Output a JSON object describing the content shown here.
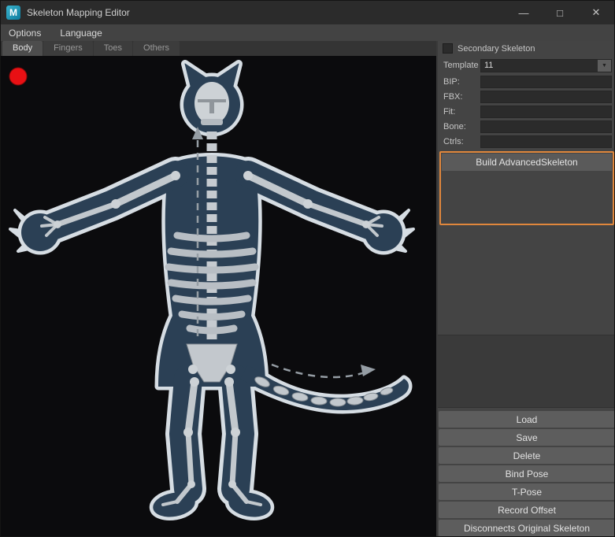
{
  "titlebar": {
    "logo_text": "M",
    "title": "Skeleton Mapping Editor",
    "minimize": "—",
    "maximize": "□",
    "close": "✕"
  },
  "menubar": {
    "options": "Options",
    "language": "Language"
  },
  "tabs": {
    "body": "Body",
    "fingers": "Fingers",
    "toes": "Toes",
    "others": "Others"
  },
  "panel": {
    "secondary_skeleton": "Secondary Skeleton",
    "secondary_skeleton_checked": false,
    "template_label": "Template",
    "template_value": "11",
    "fields": [
      {
        "label": "BIP:",
        "value": ""
      },
      {
        "label": "FBX:",
        "value": ""
      },
      {
        "label": "Fit:",
        "value": ""
      },
      {
        "label": "Bone:",
        "value": ""
      },
      {
        "label": "Ctrls:",
        "value": ""
      }
    ],
    "build_button": "Build AdvancedSkeleton",
    "buttons": [
      "Load",
      "Save",
      "Delete",
      "Bind Pose",
      "T-Pose",
      "Record Offset",
      "Disconnects Original Skeleton"
    ]
  },
  "icons": {
    "dropdown_arrow": "▼"
  },
  "colors": {
    "accent_orange": "#e0873c",
    "record_red": "#e81014",
    "body_fill": "#2b4055",
    "character_outline": "#d6dde3",
    "bone": "#c2c8cd",
    "canvas_bg": "#0b0b0d",
    "panel_bg": "#444444",
    "titlebar_bg": "#2b2b2b"
  }
}
